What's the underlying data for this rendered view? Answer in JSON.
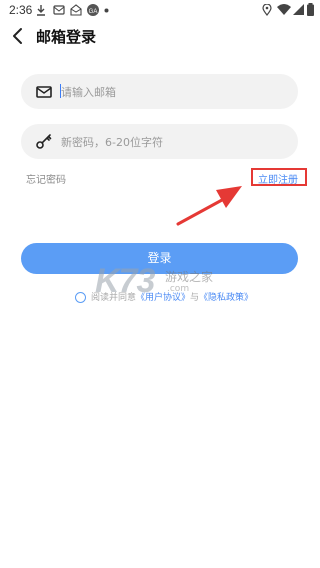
{
  "status_bar": {
    "time": "2:36"
  },
  "header": {
    "title": "邮箱登录"
  },
  "email_field": {
    "placeholder": "请输入邮箱"
  },
  "password_field": {
    "placeholder": "新密码，6-20位字符"
  },
  "links": {
    "forgot": "忘记密码",
    "register": "立即注册"
  },
  "login_button": {
    "label": "登录"
  },
  "agreement": {
    "prefix": "阅读并同意",
    "user_agreement": "《用户协议》",
    "connector": "与",
    "privacy_policy": "《隐私政策》"
  },
  "watermark": {
    "logo": "K73",
    "text1": "游戏之家",
    "text2": ".com"
  },
  "colors": {
    "accent": "#5b9df5",
    "link": "#4a8af4",
    "annotation": "#e53935"
  }
}
